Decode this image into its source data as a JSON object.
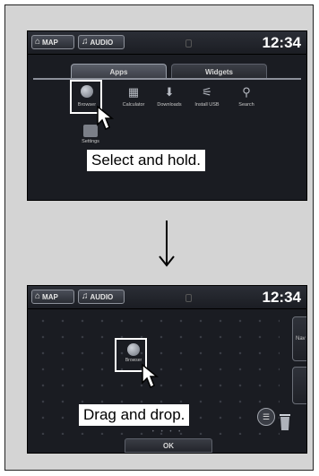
{
  "topbar": {
    "map_label": "MAP",
    "audio_label": "AUDIO",
    "clock": "12:34"
  },
  "screen1": {
    "tabs": [
      "Apps",
      "Widgets"
    ],
    "apps": [
      {
        "label": "Browser",
        "icon": "globe-icon"
      },
      {
        "label": "Calculator",
        "icon": "calculator-icon"
      },
      {
        "label": "Downloads",
        "icon": "download-icon"
      },
      {
        "label": "Install USB",
        "icon": "usb-icon"
      },
      {
        "label": "Search",
        "icon": "search-icon"
      }
    ],
    "second_row_app": {
      "label": "Settings",
      "icon": "settings-icon"
    },
    "callout": "Select and hold."
  },
  "screen2": {
    "moved_app_label": "Browser",
    "side_panel_label": "Nav",
    "callout": "Drag and drop.",
    "ok_label": "OK",
    "page_dots": "• • • •"
  },
  "colors": {
    "frame_bg": "#d4d4d4",
    "screen_bg": "#1a1c22",
    "callout_bg": "#ffffff"
  }
}
